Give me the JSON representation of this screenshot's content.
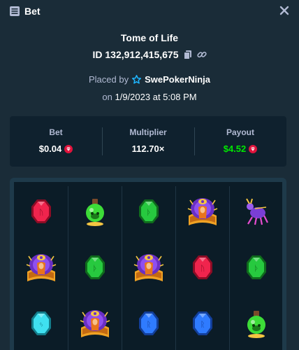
{
  "header": {
    "title": "Bet",
    "bet_icon": "slots-icon",
    "close_icon": "close-icon"
  },
  "game": {
    "name": "Tome of Life",
    "bet_id": "ID 132,912,415,675"
  },
  "placed": {
    "label": "Placed by",
    "user": "SwePokerNinja",
    "user_icon": "star-icon"
  },
  "date": {
    "prefix": "on",
    "value": "1/9/2023 at 5:08 PM"
  },
  "stats": {
    "bet_label": "Bet",
    "bet_value": "$0.04",
    "multiplier_label": "Multiplier",
    "multiplier_value": "112.70×",
    "payout_label": "Payout",
    "payout_value": "$4.52",
    "currency_icon": "ruby-coin-icon"
  },
  "colors": {
    "background": "#1a2c38",
    "panel": "#0f212e",
    "muted": "#b1bad3",
    "win": "#00e701",
    "coin": "#e0133c"
  },
  "reels": [
    [
      "red-gem",
      "book-of-life",
      "cyan-gem"
    ],
    [
      "green-potion",
      "green-gem",
      "book-of-life"
    ],
    [
      "green-gem",
      "book-of-life",
      "blue-gem"
    ],
    [
      "book-of-life",
      "red-gem",
      "blue-gem"
    ],
    [
      "purple-spider",
      "green-gem",
      "green-potion"
    ]
  ]
}
